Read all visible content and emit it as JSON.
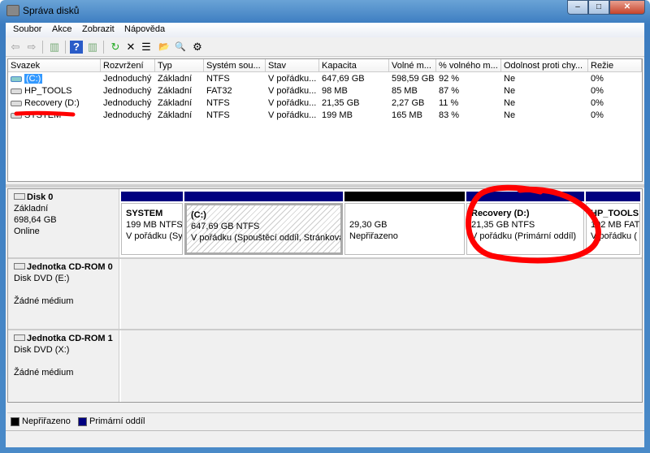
{
  "window": {
    "title": "Správa disků",
    "min": "–",
    "max": "□",
    "close": "✕"
  },
  "menu": [
    "Soubor",
    "Akce",
    "Zobrazit",
    "Nápověda"
  ],
  "toolbar": {
    "back": "⇦",
    "forward": "⇨",
    "console": "▥",
    "help": "?",
    "action_pane": "▥",
    "refresh": "↻",
    "delete": "✕",
    "properties": "☰",
    "open": "📂",
    "explore": "🔍",
    "settings": "⚙"
  },
  "volumes": {
    "columns": [
      "Svazek",
      "Rozvržení",
      "Typ",
      "Systém sou...",
      "Stav",
      "Kapacita",
      "Volné m...",
      "% volného m...",
      "Odolnost proti chy...",
      "Režie"
    ],
    "rows": [
      [
        "(C:)",
        "Jednoduchý",
        "Základní",
        "NTFS",
        "V pořádku...",
        "647,69 GB",
        "598,59 GB",
        "92 %",
        "Ne",
        "0%"
      ],
      [
        "HP_TOOLS",
        "Jednoduchý",
        "Základní",
        "FAT32",
        "V pořádku...",
        "98 MB",
        "85 MB",
        "87 %",
        "Ne",
        "0%"
      ],
      [
        "Recovery (D:)",
        "Jednoduchý",
        "Základní",
        "NTFS",
        "V pořádku...",
        "21,35 GB",
        "2,27 GB",
        "11 %",
        "Ne",
        "0%"
      ],
      [
        "SYSTEM",
        "Jednoduchý",
        "Základní",
        "NTFS",
        "V pořádku...",
        "199 MB",
        "165 MB",
        "83 %",
        "Ne",
        "0%"
      ]
    ]
  },
  "disks": [
    {
      "name": "Disk 0",
      "type": "Základní",
      "size": "698,64 GB",
      "status": "Online",
      "partitions": [
        {
          "name": "SYSTEM",
          "size": "199 MB NTFS",
          "status": "V pořádku (Sy"
        },
        {
          "name": "(C:)",
          "size": "647,69 GB NTFS",
          "status": "V pořádku (Spouštěcí oddíl, Stránkovac"
        },
        {
          "name": "",
          "size": "29,30 GB",
          "status": "Nepřiřazeno"
        },
        {
          "name": "Recovery  (D:)",
          "size": "21,35 GB NTFS",
          "status": "V pořádku (Primární oddíl)"
        },
        {
          "name": "HP_TOOLS",
          "size": "102 MB FAT",
          "status": "V pořádku ("
        }
      ]
    },
    {
      "name": "Jednotka CD-ROM 0",
      "type": "Disk DVD (E:)",
      "status": "Žádné médium"
    },
    {
      "name": "Jednotka CD-ROM 1",
      "type": "Disk DVD (X:)",
      "status": "Žádné médium"
    }
  ],
  "legend": [
    {
      "label": "Nepřiřazeno",
      "color": "#000000"
    },
    {
      "label": "Primární oddíl",
      "color": "#000080"
    }
  ],
  "colors": {
    "primary": "#000080",
    "unallocated": "#000000",
    "annotation": "#ff0000"
  }
}
